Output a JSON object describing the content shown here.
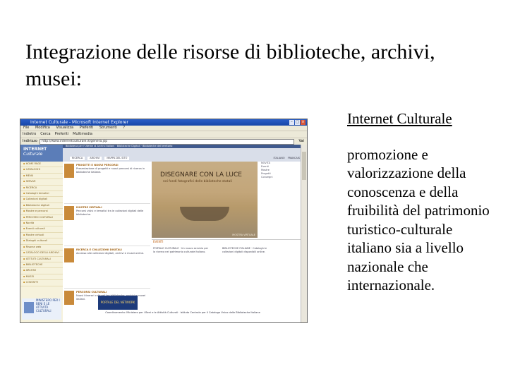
{
  "slide": {
    "title": "Integrazione delle risorse di biblioteche, archivi, musei:",
    "link": "Internet Culturale",
    "description": "promozione e valorizzazione della conoscenza e della fruibilità del patrimonio turistico-culturale italiano sia a livello nazionale che internazionale."
  },
  "browser": {
    "window_title": "Internet Culturale - Microsoft Internet Explorer",
    "menu": [
      "File",
      "Modifica",
      "Visualizza",
      "Preferiti",
      "Strumenti",
      "?"
    ],
    "toolbar": [
      "Indietro",
      "Cerca",
      "Preferiti",
      "Multimedia"
    ],
    "address_label": "Indirizzo",
    "address_value": "http://www.internetculturale.it/genera.jsp",
    "go_label": "Vai"
  },
  "site": {
    "logo_line1": "INTERNET",
    "logo_line2": "Culturale",
    "strip_text": "Biblioteca per l'Utente di Archivi Italiani · Biblioteche Digitali · Biblioteche del territorio",
    "tabs": [
      "RICERCA",
      "ARCHIVI",
      "MAPPA DEL SITO"
    ],
    "lang": [
      "ITALIANO",
      "FRANCAIS"
    ],
    "sidebar": [
      "HOME PAGE",
      "CATALOGHI",
      "MENU",
      "SERVIZI",
      "RICERCA",
      "Cataloghi tematici",
      "Collezioni digitali",
      "Biblioteche digitali",
      "Mostre e percorsi",
      "PERCORSI CULTURALI",
      "Novità",
      "Eventi culturali",
      "Mostre virtuali",
      "Dialoghi culturali",
      "Risorse web",
      "CATALOGO DEGLI ARCHIVI",
      "ISTITUTI CULTURALI",
      "BIBLIOTECHE",
      "ARCHIVI",
      "MUSEI",
      "CONTATTI"
    ],
    "side_logo": "MINISTERO PER I BENI E LE ATTIVITÀ CULTURALI",
    "articles": [
      {
        "title": "PROGETTI E NUOVI PERCORSI",
        "text": "Presentazione di progetti e nuovi percorsi di ricerca in biblioteche italiane."
      },
      {
        "title": "MOSTRE VIRTUALI",
        "text": "Percorsi visivi e tematici tra le collezioni digitali delle biblioteche."
      },
      {
        "title": "RICERCA E COLLEZIONI DIGITALI",
        "text": "Accesso alle collezioni digitali, archivi e musei online."
      },
      {
        "title": "PERCORSI CULTURALI",
        "text": "Nuovi itinerari culturali tra biblioteche, archivi e musei italiani."
      }
    ],
    "hero_title": "DISEGNARE CON LA LUCE",
    "hero_sub": "nei fondi fotografici delle biblioteche statali",
    "hero_caption": "MOSTRA VIRTUALE",
    "hero_right": [
      "NOVITÀ",
      "Eventi",
      "Mostre",
      "Progetti",
      "Convegni"
    ],
    "lower_heading": "EVENTI",
    "lower_cols": [
      "PORTALE CULTURALE · Un nuovo servizio per la ricerca nel patrimonio culturale italiano.",
      "BIBLIOTECHE ITALIANE · Cataloghi e collezioni digitali disponibili online."
    ],
    "partner": "PORTALE DEL NETWORK",
    "footer": "Coordinamento: Ministero per i Beni e le Attività Culturali · Istituto Centrale per il Catalogo Unico delle Biblioteche Italiane"
  }
}
